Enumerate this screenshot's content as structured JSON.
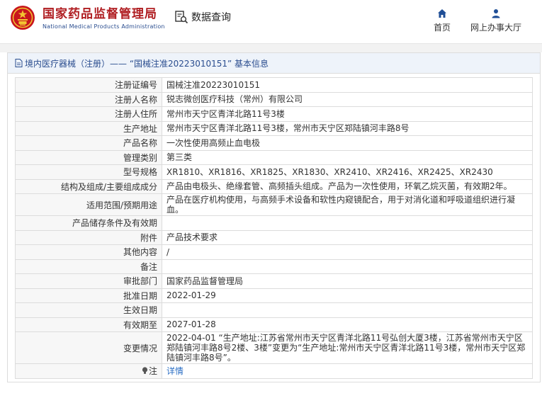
{
  "header": {
    "brand_cn": "国家药品监督管理局",
    "brand_en": "National Medical Products Administration",
    "query_label": "数据查询",
    "nav": {
      "home": "首页",
      "service": "网上办事大厅"
    }
  },
  "panel": {
    "title": "境内医疗器械（注册）—— “国械注准20223010151” 基本信息"
  },
  "rows": [
    {
      "label": "注册证编号",
      "value": "国械注准20223010151"
    },
    {
      "label": "注册人名称",
      "value": "锐志微创医疗科技（常州）有限公司"
    },
    {
      "label": "注册人住所",
      "value": "常州市天宁区青洋北路11号3楼"
    },
    {
      "label": "生产地址",
      "value": "常州市天宁区青洋北路11号3楼，常州市天宁区郑陆镇河丰路8号"
    },
    {
      "label": "产品名称",
      "value": "一次性使用高频止血电极"
    },
    {
      "label": "管理类别",
      "value": "第三类"
    },
    {
      "label": "型号规格",
      "value": "XR1810、XR1816、XR1825、XR1830、XR2410、XR2416、XR2425、XR2430"
    },
    {
      "label": "结构及组成/主要组成成分",
      "value": "产品由电极头、绝缘套管、高频插头组成。产品为一次性使用，环氧乙烷灭菌，有效期2年。"
    },
    {
      "label": "适用范围/预期用途",
      "value": "产品在医疗机构使用，与高频手术设备和软性内窥镜配合，用于对消化道和呼吸道组织进行凝血。"
    },
    {
      "label": "产品储存条件及有效期",
      "value": ""
    },
    {
      "label": "附件",
      "value": "产品技术要求"
    },
    {
      "label": "其他内容",
      "value": "/"
    },
    {
      "label": "备注",
      "value": ""
    },
    {
      "label": "审批部门",
      "value": "国家药品监督管理局"
    },
    {
      "label": "批准日期",
      "value": "2022-01-29"
    },
    {
      "label": "生效日期",
      "value": ""
    },
    {
      "label": "有效期至",
      "value": "2027-01-28"
    },
    {
      "label": "变更情况",
      "value": "2022-04-01 “生产地址:江苏省常州市天宁区青洋北路11号弘创大厦3楼，江苏省常州市天宁区郑陆镇河丰路8号2楼、3楼”变更为“生产地址:常州市天宁区青洋北路11号3楼，常州市天宁区郑陆镇河丰路8号”。"
    },
    {
      "label": "注",
      "value": "详情"
    }
  ],
  "colors": {
    "brand_red": "#b01e22",
    "brand_blue": "#2a4d8f",
    "link_blue": "#2a6ec4"
  }
}
